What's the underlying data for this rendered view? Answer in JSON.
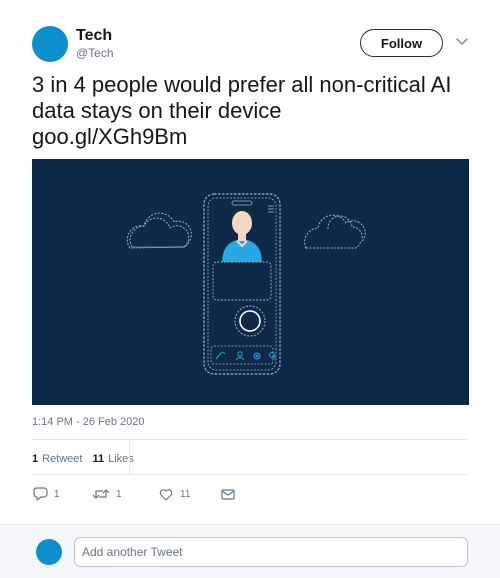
{
  "author": {
    "name": "Tech",
    "handle": "@Tech",
    "avatar_color": "#0e8ecb"
  },
  "follow_button": {
    "label": "Follow"
  },
  "tweet": {
    "text": "3 in 4 people would prefer all non-critical AI data stays on their device",
    "link": "goo.gl/XGh9Bm",
    "timestamp": "1:14 PM - 26 Feb 2020"
  },
  "media": {
    "background_color": "#0c2948",
    "accent_color": "#2aa7e0",
    "icons": [
      "cloud-icon",
      "phone-illustration",
      "person-icon",
      "home-button-icon",
      "pencil-icon",
      "user-icon",
      "settings-icon",
      "search-icon"
    ]
  },
  "stats": {
    "retweets_count": "1",
    "retweets_label": "Retweet",
    "likes_count": "11",
    "likes_label": "Likes"
  },
  "actions": {
    "reply_count": "1",
    "retweet_count": "1",
    "like_count": "11"
  },
  "reply": {
    "placeholder": "Add another Tweet"
  },
  "colors": {
    "text": "#14171a",
    "muted": "#657786",
    "divider": "#e6ecf0",
    "reply_bar": "#f5f8fa"
  }
}
